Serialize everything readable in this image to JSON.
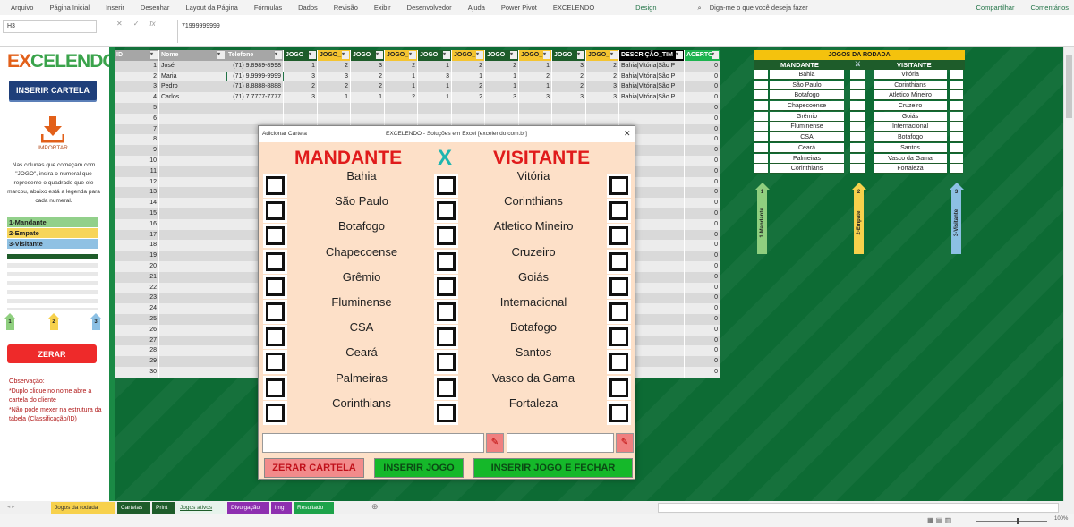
{
  "ribbon": {
    "tabs": [
      "Arquivo",
      "Página Inicial",
      "Inserir",
      "Desenhar",
      "Layout da Página",
      "Fórmulas",
      "Dados",
      "Revisão",
      "Exibir",
      "Desenvolvedor",
      "Ajuda",
      "Power Pivot",
      "EXCELENDO",
      "Design"
    ],
    "search_placeholder": "Diga-me o que você deseja fazer",
    "share": "Compartilhar",
    "comments": "Comentários"
  },
  "formula_bar": {
    "name_box": "H3",
    "value": "71999999999"
  },
  "left_panel": {
    "logo": "EXCELENDO",
    "insert_button": "INSERIR CARTELA",
    "import_label": "IMPORTAR",
    "instructions": "Nas colunas que começam com \"JOGO\", insira o numeral que represente o quadrado que ele marcou, abaixo está a legenda para cada numeral.",
    "legend": [
      {
        "label": "1-Mandante",
        "color": "#92d08a"
      },
      {
        "label": "2-Empate",
        "color": "#f7d55a"
      },
      {
        "label": "3-Visitante",
        "color": "#8fc1e3"
      }
    ],
    "arrow_numbers": [
      "1",
      "2",
      "3"
    ],
    "reset_button": "ZERAR",
    "notes": [
      "Observação:",
      "*Duplo clique no nome abre a cartela do cliente",
      "*Não pode mexer na estrutura da tabela (Classificação/ID)"
    ]
  },
  "table": {
    "headers": [
      "ID",
      "Nome",
      "Telefone",
      "JOGO",
      "JOGO_",
      "JOGO",
      "JOGO_",
      "JOGO",
      "JOGO_",
      "JOGO",
      "JOGO_",
      "JOGO",
      "JOGO_",
      "DESCRIÇÃO_TIM",
      "ACERTO"
    ],
    "rows": [
      {
        "id": "1",
        "nome": "José",
        "telefone": "(71) 9.8989-8998",
        "jogos": [
          "1",
          "2",
          "3",
          "2",
          "1",
          "2",
          "2",
          "1",
          "3",
          "2"
        ],
        "descricao": "Bahia|Vitória|São P",
        "acerto": "0"
      },
      {
        "id": "2",
        "nome": "Maria",
        "telefone": "(71) 9.9999-9999",
        "jogos": [
          "3",
          "3",
          "2",
          "1",
          "3",
          "1",
          "1",
          "2",
          "2",
          "2"
        ],
        "descricao": "Bahia|Vitória|São P",
        "acerto": "0"
      },
      {
        "id": "3",
        "nome": "Pedro",
        "telefone": "(71) 8.8888-8888",
        "jogos": [
          "2",
          "2",
          "2",
          "1",
          "1",
          "2",
          "1",
          "1",
          "2",
          "3"
        ],
        "descricao": "Bahia|Vitória|São P",
        "acerto": "0"
      },
      {
        "id": "4",
        "nome": "Carlos",
        "telefone": "(71) 7.7777-7777",
        "jogos": [
          "3",
          "1",
          "1",
          "2",
          "1",
          "2",
          "3",
          "3",
          "3",
          "3"
        ],
        "descricao": "Bahia|Vitória|São P",
        "acerto": "0"
      }
    ],
    "empty_ids": [
      "5",
      "6",
      "7",
      "8",
      "9",
      "10",
      "11",
      "12",
      "13",
      "14",
      "15",
      "16",
      "17",
      "18",
      "19",
      "20",
      "21",
      "22",
      "23",
      "24",
      "25",
      "26",
      "27",
      "28",
      "29",
      "30"
    ],
    "empty_acerto": "0"
  },
  "dialog": {
    "title": "Adicionar Cartela",
    "caption": "EXCELENDO - Soluções em Excel [excelendo.com.br]",
    "close": "✕",
    "home_header": "MANDANTE",
    "vs": "X",
    "away_header": "VISITANTE",
    "games": [
      {
        "home": "Bahia",
        "away": "Vitória"
      },
      {
        "home": "São Paulo",
        "away": "Corinthians"
      },
      {
        "home": "Botafogo",
        "away": "Atletico Mineiro"
      },
      {
        "home": "Chapecoense",
        "away": "Cruzeiro"
      },
      {
        "home": "Grêmio",
        "away": "Goiás"
      },
      {
        "home": "Fluminense",
        "away": "Internacional"
      },
      {
        "home": "CSA",
        "away": "Botafogo"
      },
      {
        "home": "Ceará",
        "away": "Santos"
      },
      {
        "home": "Palmeiras",
        "away": "Vasco da Gama"
      },
      {
        "home": "Corinthians",
        "away": "Fortaleza"
      }
    ],
    "name_input": "",
    "phone_input": "",
    "buttons": {
      "reset": "ZERAR CARTELA",
      "insert": "INSERIR JOGO",
      "insert_close": "INSERIR JOGO E FECHAR"
    }
  },
  "right_panel": {
    "title": "JOGOS DA RODADA",
    "home_header": "MANDANTE",
    "away_header": "VISITANTE",
    "arrows": [
      {
        "num": "1",
        "label": "1-Mandante",
        "color": "#8fcf7f"
      },
      {
        "num": "2",
        "label": "2-Empate",
        "color": "#f7d14c"
      },
      {
        "num": "3",
        "label": "3-Visitante",
        "color": "#8cc0e4"
      }
    ]
  },
  "sheet_tabs": [
    {
      "label": "Jogos da rodada",
      "color": "#f7d14c",
      "text": "#333"
    },
    {
      "label": "Cartelas",
      "color": "#1e5c2a",
      "text": "#fff"
    },
    {
      "label": "Print",
      "color": "#1e5c2a",
      "text": "#fff"
    },
    {
      "label": "Jogos ativos",
      "color": "#e7f3ec",
      "text": "#1e5c2a",
      "active": true
    },
    {
      "label": "Divulgação",
      "color": "#8e2fb0",
      "text": "#fff"
    },
    {
      "label": "img",
      "color": "#8e2fb0",
      "text": "#fff"
    },
    {
      "label": "Resultado",
      "color": "#1da34a",
      "text": "#fff"
    }
  ],
  "status": {
    "zoom": "100%"
  }
}
